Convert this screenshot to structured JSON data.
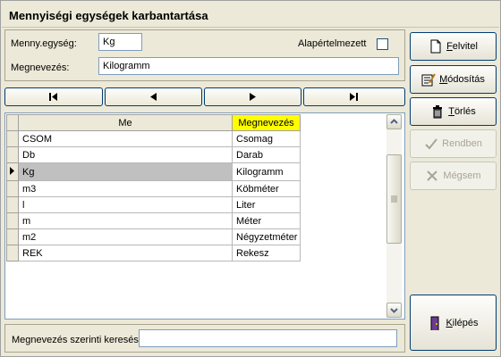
{
  "window": {
    "title": "Mennyiségi egységek karbantartása"
  },
  "form": {
    "unit_label": "Menny.egység:",
    "unit_value": "Kg",
    "default_label": "Alapértelmezett",
    "default_checked": false,
    "name_label": "Megnevezés:",
    "name_value": "Kilogramm"
  },
  "navigator": {
    "first": "|◀",
    "prev": "◀",
    "next": "▶",
    "last": "▶|"
  },
  "grid": {
    "columns": [
      "Me",
      "Megnevezés"
    ],
    "sorted_column": "Megnevezés",
    "rows": [
      {
        "me": "CSOM",
        "megnevezes": "Csomag"
      },
      {
        "me": "Db",
        "megnevezes": "Darab"
      },
      {
        "me": "Kg",
        "megnevezes": "Kilogramm"
      },
      {
        "me": "m3",
        "megnevezes": "Köbméter"
      },
      {
        "me": "l",
        "megnevezes": "Liter"
      },
      {
        "me": "m",
        "megnevezes": "Méter"
      },
      {
        "me": "m2",
        "megnevezes": "Négyzetméter"
      },
      {
        "me": "REK",
        "megnevezes": "Rekesz"
      }
    ],
    "selected_index": 2
  },
  "search": {
    "label": "Megnevezés szerinti keresés",
    "value": ""
  },
  "buttons": {
    "felvitel": "Felvitel",
    "modositas": "Módosítás",
    "torles": "Törlés",
    "rendben": "Rendben",
    "megsem": "Mégsem",
    "kilepes": "Kilépés"
  },
  "colors": {
    "window_bg": "#ece9d8",
    "sorted_header": "#fffe00",
    "selected_cell": "#c0c0c0",
    "button_border": "#003c74",
    "input_border": "#7f9db9"
  }
}
